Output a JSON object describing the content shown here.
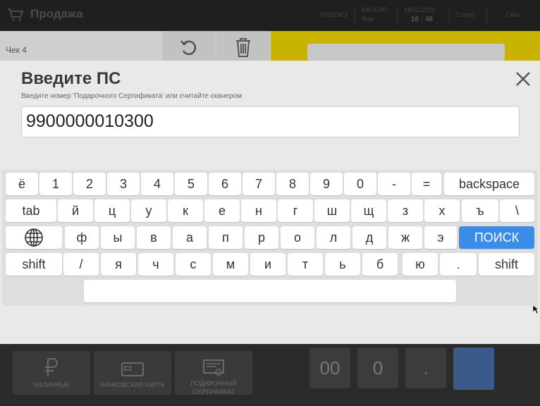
{
  "header": {
    "title": "Продажа",
    "shop": "ТОШОКО",
    "cashier_label": "КАССИР",
    "cashier_name": "Яна",
    "date": "18/11/2021",
    "time": "16 : 46",
    "status": "Статус",
    "network": "Сеть"
  },
  "check": {
    "label": "Чек 4"
  },
  "modal": {
    "title": "Введите ПС",
    "subtitle": "Введите номер 'Подарочного Сертификата' или считайте сканером",
    "input_value": "9900000010300"
  },
  "keyboard": {
    "row1": [
      "ё",
      "1",
      "2",
      "3",
      "4",
      "5",
      "6",
      "7",
      "8",
      "9",
      "0",
      "-",
      "=",
      "backspace"
    ],
    "row2": [
      "tab",
      "й",
      "ц",
      "у",
      "к",
      "е",
      "н",
      "г",
      "ш",
      "щ",
      "з",
      "х",
      "ъ",
      "\\"
    ],
    "row3": [
      "ф",
      "ы",
      "в",
      "а",
      "п",
      "р",
      "о",
      "л",
      "д",
      "ж",
      "э",
      "ПОИСК"
    ],
    "row4": [
      "shift",
      "/",
      "я",
      "ч",
      "с",
      "м",
      "и",
      "т",
      "ь",
      "б",
      "ю",
      ".",
      "shift"
    ]
  },
  "payments": {
    "cash": "НАЛИЧНЫЕ",
    "card": "БАНКОВСКАЯ КАРТА",
    "gift_line1": "ПОДАРОЧНЫЙ",
    "gift_line2": "СЕРТИФИКАТ"
  },
  "numpad": {
    "k00": "00",
    "k0": "0",
    "dot": "."
  },
  "colors": {
    "accent": "#3b8be8",
    "yellow": "#c8b400"
  }
}
